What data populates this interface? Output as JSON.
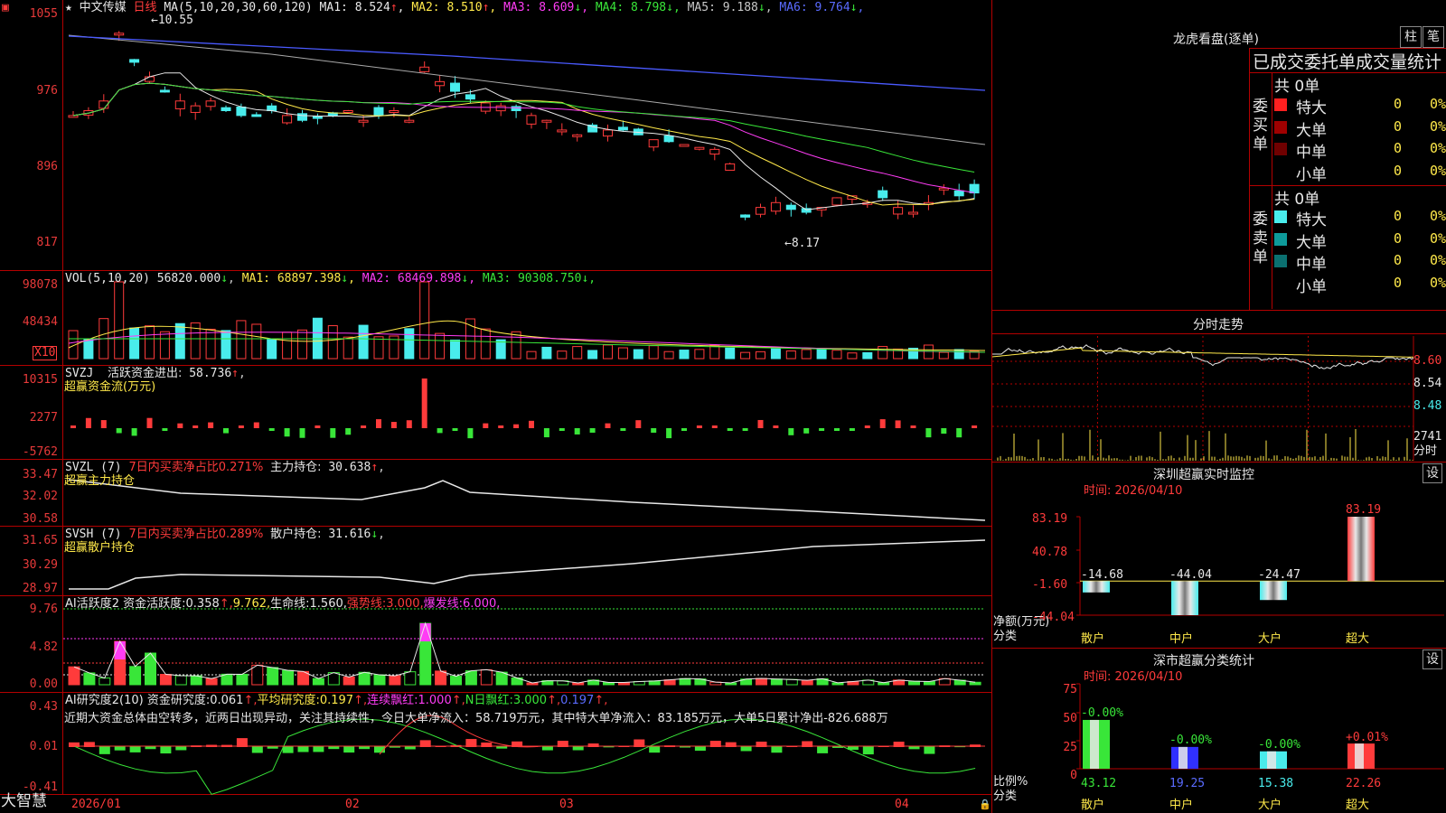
{
  "stock": {
    "star": "★",
    "name": "中文传媒",
    "period": "日线"
  },
  "kline": {
    "ma_label": "MA(5,10,20,30,60,120)",
    "ma": [
      {
        "label": "MA1:",
        "value": "8.524",
        "arrow": "↑",
        "color": "#e8e8e8"
      },
      {
        "label": "MA2:",
        "value": "8.510",
        "arrow": "↑",
        "color": "#ffe94a"
      },
      {
        "label": "MA3:",
        "value": "8.609",
        "arrow": "↓",
        "color": "#ff3cf5"
      },
      {
        "label": "MA4:",
        "value": "8.798",
        "arrow": "↓",
        "color": "#39e639"
      },
      {
        "label": "MA5:",
        "value": "9.188",
        "arrow": "↓",
        "color": "#c8c8c8"
      },
      {
        "label": "MA6:",
        "value": "9.764",
        "arrow": "↓",
        "color": "#5a6bff"
      }
    ],
    "y_ticks": [
      "1055",
      "976",
      "896",
      "817"
    ],
    "high_note": "10.55",
    "low_note": "8.17"
  },
  "vol": {
    "label": "VOL(5,10,20)",
    "value": "56820.000",
    "value_arrow": "↓",
    "ma": [
      {
        "label": "MA1:",
        "value": "68897.398",
        "arrow": "↓",
        "color": "#ffe94a"
      },
      {
        "label": "MA2:",
        "value": "68469.898",
        "arrow": "↓",
        "color": "#ff3cf5"
      },
      {
        "label": "MA3:",
        "value": "90308.750",
        "arrow": "↓",
        "color": "#39e639"
      }
    ],
    "y_ticks": [
      "98078",
      "48434"
    ],
    "unit": "X10"
  },
  "svzj": {
    "label": "SVZJ",
    "item": "活跃资金进出:",
    "value": "58.736",
    "arrow": "↑",
    "subtitle": "超赢资金流(万元)",
    "y_ticks": [
      "10315",
      "2277",
      "-5762"
    ]
  },
  "svzl": {
    "label": "SVZL (7)",
    "item1": "7日内买卖净占比0.271%",
    "item2": "主力持仓:",
    "value": "30.638",
    "arrow": "↑",
    "subtitle": "超赢主力持仓",
    "y_ticks": [
      "33.47",
      "32.02",
      "30.58"
    ]
  },
  "svsh": {
    "label": "SVSH (7)",
    "item1": "7日内买卖净占比0.289%",
    "item2": "散户持仓:",
    "value": "31.616",
    "arrow": "↓",
    "subtitle": "超赢散户持仓",
    "y_ticks": [
      "31.65",
      "30.29",
      "28.97"
    ]
  },
  "ai1": {
    "label": "AI活跃度2",
    "items": [
      {
        "text": "资金活跃度:",
        "color": "#e8e8e8"
      },
      {
        "text": "0.358",
        "color": "#e8e8e8"
      },
      {
        "text": "↑,",
        "color": "#ff3b3b"
      },
      {
        "text": "9.762,",
        "color": "#ffe94a"
      },
      {
        "text": "生命线:",
        "color": "#e8e8e8"
      },
      {
        "text": "1.560,",
        "color": "#e8e8e8"
      },
      {
        "text": "强势线:",
        "color": "#ff3b3b"
      },
      {
        "text": "3.000,",
        "color": "#ff3b3b"
      },
      {
        "text": "爆发线:",
        "color": "#ff3cf5"
      },
      {
        "text": "6.000,",
        "color": "#ff3cf5"
      }
    ],
    "y_ticks": [
      "9.76",
      "4.82",
      "0.00"
    ]
  },
  "ai2": {
    "label": "AI研究度2(10)",
    "items": [
      {
        "text": "资金研究度:",
        "color": "#e8e8e8"
      },
      {
        "text": "0.061",
        "color": "#e8e8e8"
      },
      {
        "text": "↑,",
        "color": "#ff3b3b"
      },
      {
        "text": "平均研究度:",
        "color": "#ffe94a"
      },
      {
        "text": "0.197",
        "color": "#ffe94a"
      },
      {
        "text": "↑,",
        "color": "#ff3b3b"
      },
      {
        "text": "连续飘红:",
        "color": "#ff3cf5"
      },
      {
        "text": "1.000",
        "color": "#ff3cf5"
      },
      {
        "text": "↑,",
        "color": "#ff3b3b"
      },
      {
        "text": "N日飘红:",
        "color": "#39e639"
      },
      {
        "text": "3.000",
        "color": "#39e639"
      },
      {
        "text": "↑,",
        "color": "#ff3b3b"
      },
      {
        "text": "0.197",
        "color": "#5a6bff"
      },
      {
        "text": "↑,",
        "color": "#ff3b3b"
      }
    ],
    "comment": "近期大资金总体由空转多，近两日出现异动，关注其持续性，今日大单净流入：58.719万元，其中特大单净流入：83.185万元，大单5日累计净出-826.688万",
    "y_ticks": [
      "0.43",
      "0.01",
      "-0.41"
    ]
  },
  "x_axis": {
    "labels": [
      "2026/01",
      "02",
      "03",
      "04"
    ]
  },
  "brand": "大智慧",
  "lhb": {
    "title": "龙虎看盘(逐单)",
    "btn1": "柱",
    "btn2": "笔",
    "subtitle": "已成交委托单成交量统计",
    "buy": {
      "side": "委买单",
      "total": "共 0单",
      "rows": [
        {
          "name": "特大",
          "v1": "0",
          "v2": "0%",
          "color": "#ff2020"
        },
        {
          "name": "大单",
          "v1": "0",
          "v2": "0%",
          "color": "#a00000"
        },
        {
          "name": "中单",
          "v1": "0",
          "v2": "0%",
          "color": "#700000"
        },
        {
          "name": "小单",
          "v1": "0",
          "v2": "0%",
          "color": "#000000"
        }
      ]
    },
    "sell": {
      "side": "委卖单",
      "total": "共 0单",
      "rows": [
        {
          "name": "特大",
          "v1": "0",
          "v2": "0%",
          "color": "#49ecec"
        },
        {
          "name": "大单",
          "v1": "0",
          "v2": "0%",
          "color": "#0e9a9a"
        },
        {
          "name": "中单",
          "v1": "0",
          "v2": "0%",
          "color": "#0b7070"
        },
        {
          "name": "小单",
          "v1": "0",
          "v2": "0%",
          "color": "#000000"
        }
      ]
    }
  },
  "fenshi": {
    "title": "分时走势",
    "y_ticks": [
      "8.60",
      "8.54",
      "8.48"
    ],
    "vol_tick": "2741",
    "vol_unit": "分时"
  },
  "monitor": {
    "title": "深圳超赢实时监控",
    "btn": "设",
    "time": "时间: 2026/04/10",
    "y_ticks": [
      "83.19",
      "40.78",
      "-1.60",
      "-44.04"
    ],
    "ylabel": "净额(万元)",
    "xlabel": "分类",
    "categories": [
      "散户",
      "中户",
      "大户",
      "超大"
    ],
    "values": [
      "-14.68",
      "-44.04",
      "-24.47",
      "83.19"
    ]
  },
  "classify": {
    "title": "深市超赢分类统计",
    "btn": "设",
    "time": "时间: 2026/04/10",
    "y_ticks": [
      "75",
      "50",
      "25",
      "0"
    ],
    "ylabel": "比例%",
    "xlabel": "分类",
    "categories": [
      "散户",
      "中户",
      "大户",
      "超大"
    ],
    "values": [
      "43.12",
      "19.25",
      "15.38",
      "22.26"
    ],
    "changes": [
      "-0.00%",
      "-0.00%",
      "-0.00%",
      "+0.01%"
    ]
  },
  "chart_data": [
    {
      "type": "bar",
      "title": "深圳超赢实时监控",
      "ylabel": "净额(万元)",
      "xlabel": "分类",
      "categories": [
        "散户",
        "中户",
        "大户",
        "超大"
      ],
      "values": [
        -14.68,
        -44.04,
        -24.47,
        83.19
      ],
      "ylim": [
        -44.04,
        83.19
      ]
    },
    {
      "type": "bar",
      "title": "深市超赢分类统计",
      "ylabel": "比例%",
      "xlabel": "分类",
      "categories": [
        "散户",
        "中户",
        "大户",
        "超大"
      ],
      "values": [
        43.12,
        19.25,
        15.38,
        22.26
      ],
      "ylim": [
        0,
        75
      ]
    }
  ]
}
